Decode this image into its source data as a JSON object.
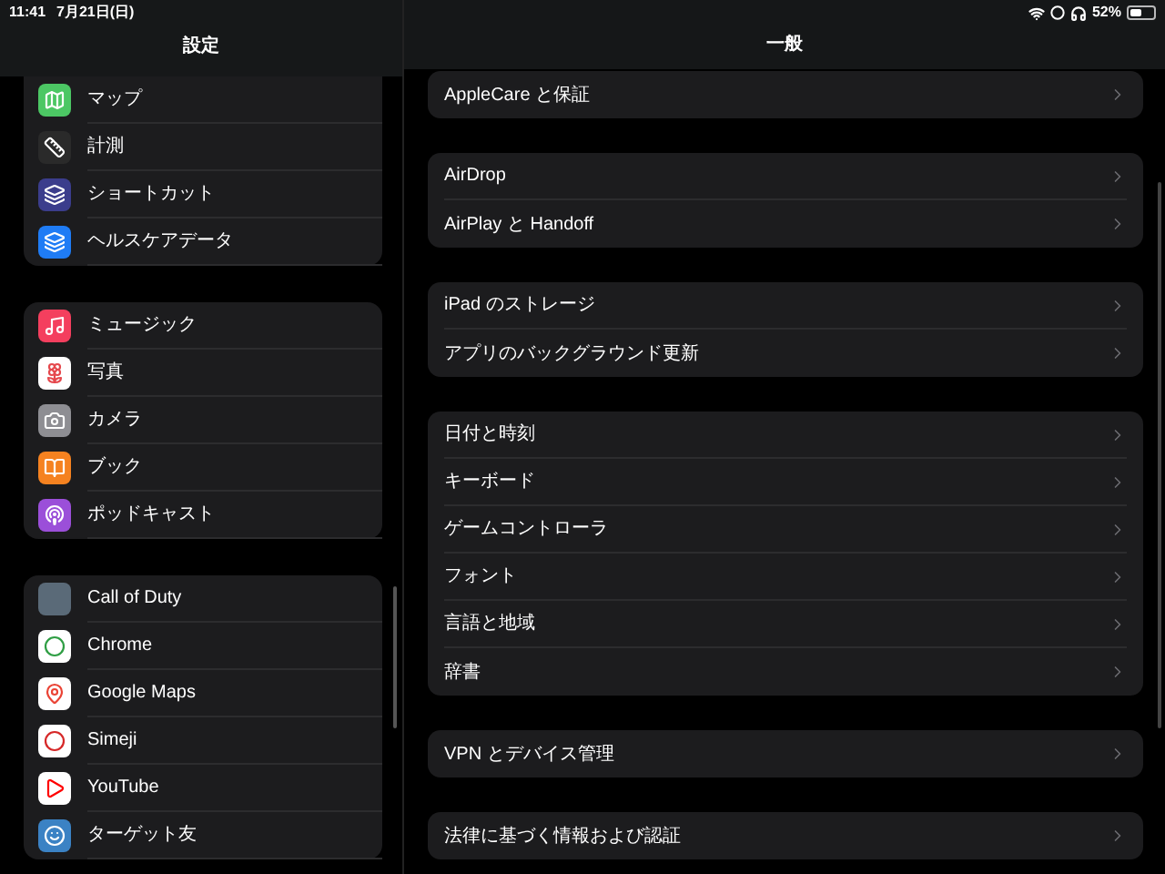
{
  "status_bar": {
    "time": "11:41",
    "date": "7月21日(日)",
    "battery": "52%"
  },
  "sidebar": {
    "title": "設定",
    "groups": [
      {
        "items": [
          {
            "label": "マップ",
            "kind": "map",
            "color": "#4cc764"
          },
          {
            "label": "計測",
            "kind": "ruler",
            "color": "#2a2a2a"
          },
          {
            "label": "ショートカット",
            "kind": "layers",
            "color": "#3b3d8c"
          },
          {
            "label": "ヘルスケアデータ",
            "kind": "stack",
            "color": "#1f7cf5"
          }
        ]
      },
      {
        "items": [
          {
            "label": "ミュージック",
            "kind": "music",
            "color": "#f43f5e"
          },
          {
            "label": "写真",
            "kind": "flower",
            "color": "#ffffff"
          },
          {
            "label": "カメラ",
            "kind": "camera",
            "color": "#8e8e93"
          },
          {
            "label": "ブック",
            "kind": "book",
            "color": "#f58220"
          },
          {
            "label": "ポッドキャスト",
            "kind": "podcast",
            "color": "#9b4fd9"
          }
        ]
      },
      {
        "items": [
          {
            "label": "Call of Duty",
            "kind": "photo",
            "color": "#5a6a78"
          },
          {
            "label": "Chrome",
            "kind": "chrome",
            "color": "#ffffff"
          },
          {
            "label": "Google Maps",
            "kind": "pin",
            "color": "#ffffff"
          },
          {
            "label": "Simeji",
            "kind": "ring",
            "color": "#ffffff"
          },
          {
            "label": "YouTube",
            "kind": "play",
            "color": "#ffffff"
          },
          {
            "label": "ターゲット友",
            "kind": "face",
            "color": "#3b82c4"
          }
        ]
      }
    ]
  },
  "detail": {
    "title": "一般",
    "groups": [
      {
        "items": [
          {
            "label": "AppleCare と保証"
          }
        ]
      },
      {
        "items": [
          {
            "label": "AirDrop"
          },
          {
            "label": "AirPlay と Handoff"
          }
        ]
      },
      {
        "items": [
          {
            "label": "iPad のストレージ"
          },
          {
            "label": "アプリのバックグラウンド更新"
          }
        ]
      },
      {
        "items": [
          {
            "label": "日付と時刻"
          },
          {
            "label": "キーボード"
          },
          {
            "label": "ゲームコントローラ"
          },
          {
            "label": "フォント"
          },
          {
            "label": "言語と地域"
          },
          {
            "label": "辞書"
          }
        ]
      },
      {
        "items": [
          {
            "label": "VPN とデバイス管理"
          }
        ]
      },
      {
        "items": [
          {
            "label": "法律に基づく情報および認証"
          }
        ]
      }
    ]
  }
}
